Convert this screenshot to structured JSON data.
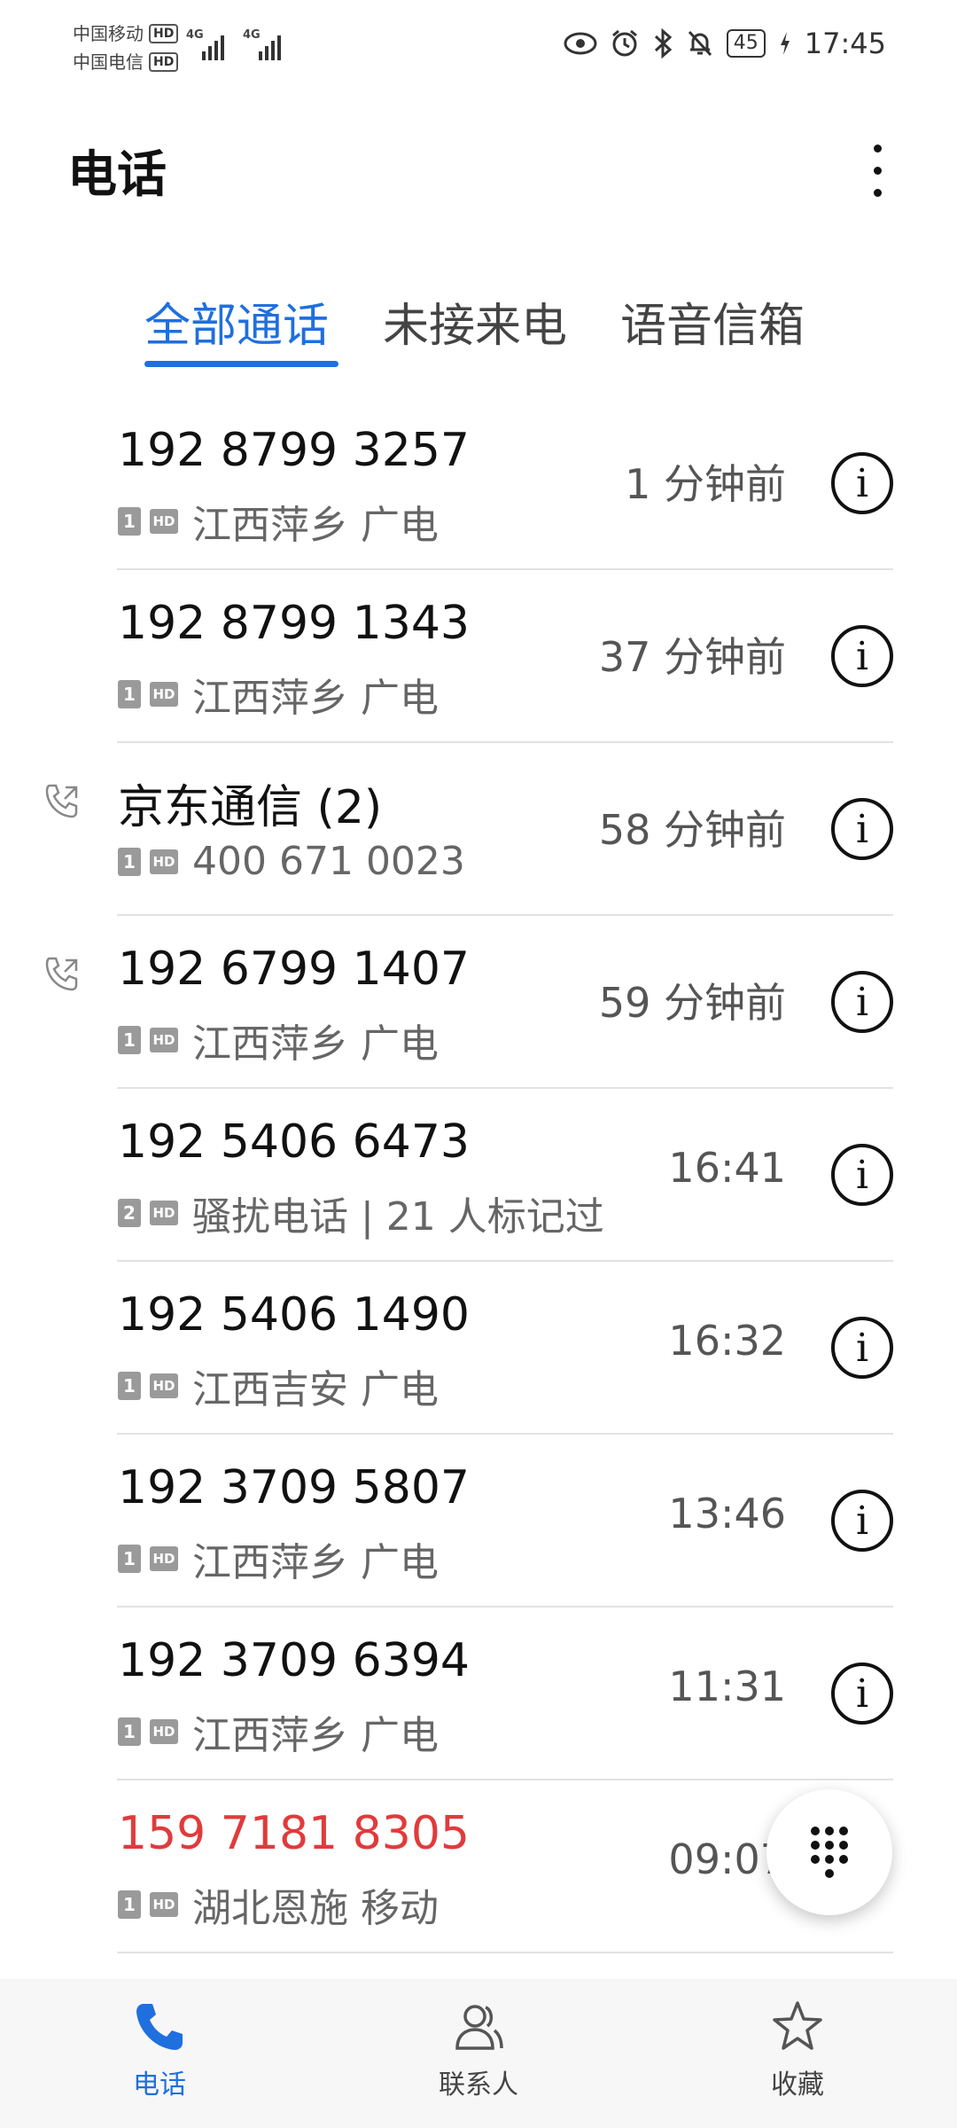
{
  "status_bar": {
    "carrier_1": "中国移动",
    "carrier_2": "中国电信",
    "hd_label": "HD",
    "net_1": "4G",
    "net_2": "4G",
    "battery": "45",
    "time": "17:45"
  },
  "header": {
    "title": "电话"
  },
  "tabs": [
    {
      "label": "全部通话",
      "active": true
    },
    {
      "label": "未接来电",
      "active": false
    },
    {
      "label": "语音信箱",
      "active": false
    }
  ],
  "calls": [
    {
      "name": "192 8799 3257",
      "sim": "1",
      "hd": "HD",
      "sub": "江西萍乡 广电",
      "time": "1 分钟前",
      "outgoing": false,
      "missed": false
    },
    {
      "name": "192 8799 1343",
      "sim": "1",
      "hd": "HD",
      "sub": "江西萍乡 广电",
      "time": "37 分钟前",
      "outgoing": false,
      "missed": false
    },
    {
      "name": "京东通信 (2)",
      "sim": "1",
      "hd": "HD",
      "sub": "400 671 0023",
      "time": "58 分钟前",
      "outgoing": true,
      "missed": false
    },
    {
      "name": "192 6799 1407",
      "sim": "1",
      "hd": "HD",
      "sub": "江西萍乡 广电",
      "time": "59 分钟前",
      "outgoing": true,
      "missed": false
    },
    {
      "name": "192 5406 6473",
      "sim": "2",
      "hd": "HD",
      "sub": "骚扰电话 | 21 人标记过",
      "time": "16:41",
      "outgoing": false,
      "missed": false
    },
    {
      "name": "192 5406 1490",
      "sim": "1",
      "hd": "HD",
      "sub": "江西吉安 广电",
      "time": "16:32",
      "outgoing": false,
      "missed": false
    },
    {
      "name": "192 3709 5807",
      "sim": "1",
      "hd": "HD",
      "sub": "江西萍乡 广电",
      "time": "13:46",
      "outgoing": false,
      "missed": false
    },
    {
      "name": "192 3709 6394",
      "sim": "1",
      "hd": "HD",
      "sub": "江西萍乡 广电",
      "time": "11:31",
      "outgoing": false,
      "missed": false
    },
    {
      "name": "159 7181 8305",
      "sim": "1",
      "hd": "HD",
      "sub": "湖北恩施 移动",
      "time": "09:07",
      "outgoing": false,
      "missed": true
    }
  ],
  "info_glyph": "i",
  "bottom_nav": [
    {
      "label": "电话",
      "icon": "phone-icon",
      "active": true
    },
    {
      "label": "联系人",
      "icon": "contacts-icon",
      "active": false
    },
    {
      "label": "收藏",
      "icon": "star-icon",
      "active": false
    }
  ],
  "colors": {
    "accent": "#1f6fde",
    "missed": "#e03b3b"
  }
}
